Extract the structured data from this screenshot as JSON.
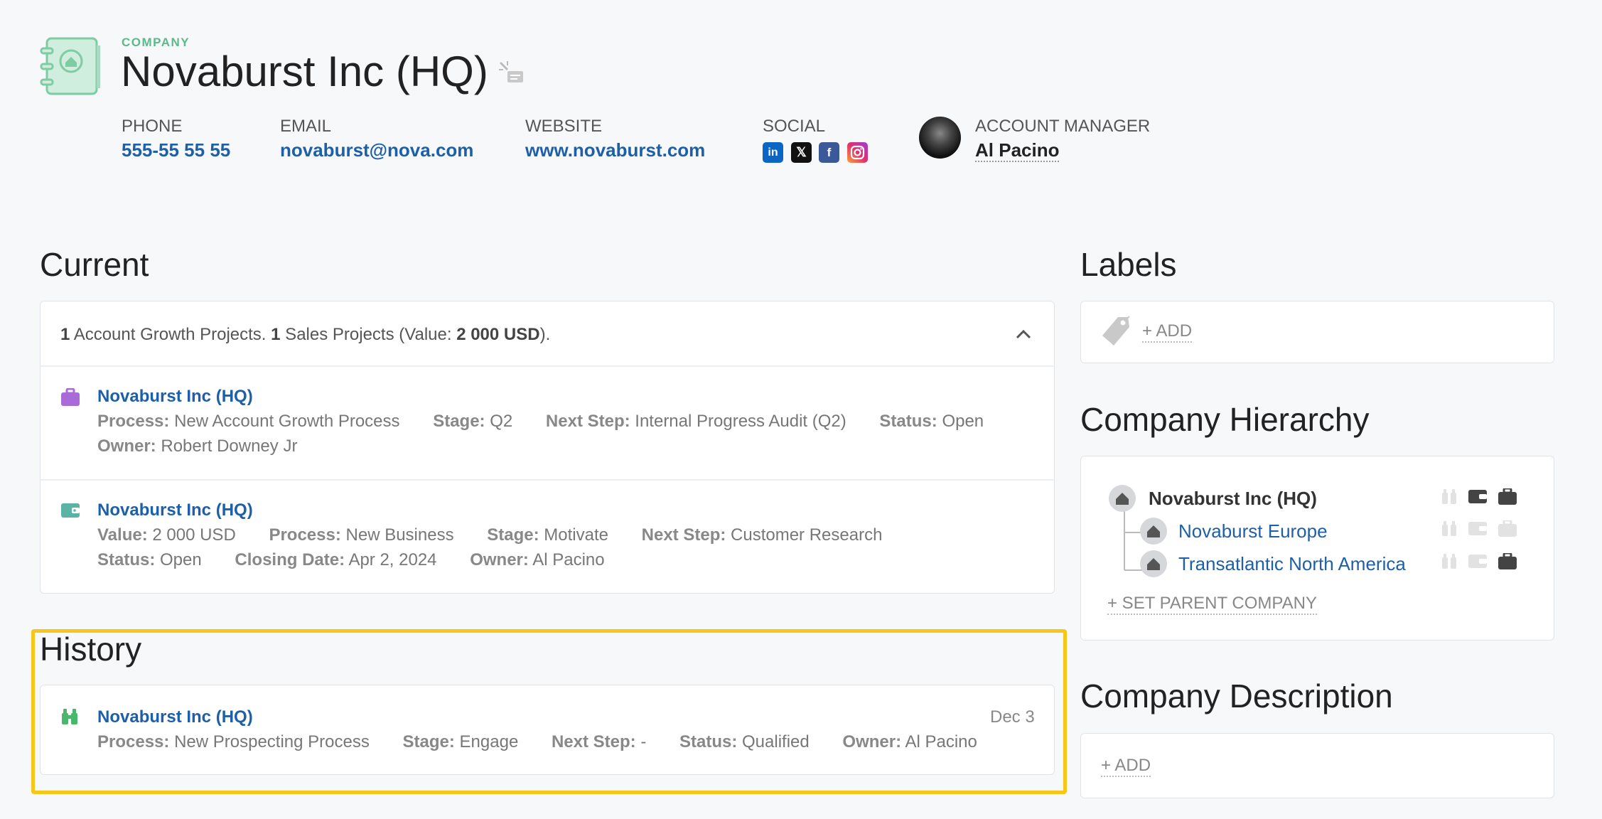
{
  "company": {
    "type_label": "COMPANY",
    "name": "Novaburst Inc (HQ)",
    "phone_label": "PHONE",
    "phone": "555-55 55 55",
    "email_label": "EMAIL",
    "email": "novaburst@nova.com",
    "website_label": "WEBSITE",
    "website": "www.novaburst.com",
    "social_label": "SOCIAL",
    "account_manager_label": "ACCOUNT MANAGER",
    "account_manager": "Al Pacino"
  },
  "current": {
    "heading": "Current",
    "summary": {
      "n1": "1",
      "t1": " Account Growth Projects. ",
      "n2": "1",
      "t2": " Sales Projects (Value: ",
      "value": "2 000 USD",
      "t3": ")."
    },
    "projects": [
      {
        "title": "Novaburst Inc (HQ)",
        "process_k": "Process:",
        "process": "New Account Growth Process",
        "stage_k": "Stage:",
        "stage": "Q2",
        "next_k": "Next Step:",
        "next": "Internal Progress Audit (Q2)",
        "status_k": "Status:",
        "status": "Open",
        "owner_k": "Owner:",
        "owner": "Robert Downey Jr"
      },
      {
        "title": "Novaburst Inc (HQ)",
        "value_k": "Value:",
        "value": "2 000 USD",
        "process_k": "Process:",
        "process": "New Business",
        "stage_k": "Stage:",
        "stage": "Motivate",
        "next_k": "Next Step:",
        "next": "Customer Research",
        "status_k": "Status:",
        "status": "Open",
        "closing_k": "Closing Date:",
        "closing": "Apr 2, 2024",
        "owner_k": "Owner:",
        "owner": "Al Pacino"
      }
    ]
  },
  "history": {
    "heading": "History",
    "items": [
      {
        "title": "Novaburst Inc (HQ)",
        "date": "Dec 3",
        "process_k": "Process:",
        "process": "New Prospecting Process",
        "stage_k": "Stage:",
        "stage": "Engage",
        "next_k": "Next Step:",
        "next": "-",
        "status_k": "Status:",
        "status": "Qualified",
        "owner_k": "Owner:",
        "owner": "Al Pacino"
      }
    ]
  },
  "labels": {
    "heading": "Labels",
    "add": "+ ADD"
  },
  "hierarchy": {
    "heading": "Company Hierarchy",
    "nodes": [
      "Novaburst Inc (HQ)",
      "Novaburst Europe",
      "Transatlantic North America"
    ],
    "set_parent": "+ SET PARENT COMPANY"
  },
  "description": {
    "heading": "Company Description",
    "add": "+ ADD"
  },
  "colors": {
    "link": "#1d5fa8",
    "accent_green": "#5cb98a",
    "highlight": "#f7c619",
    "purple": "#a86bd8",
    "teal": "#5bb3a6"
  }
}
